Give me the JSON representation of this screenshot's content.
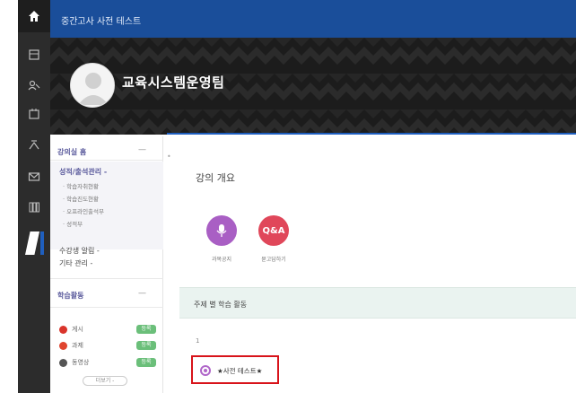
{
  "header": {
    "title": "중간고사 사전 테스트"
  },
  "banner": {
    "org_name": "교육시스템운영팀"
  },
  "sidebar": {
    "course_home": "강의실 홈",
    "course_home_toggle": "—",
    "grade_menu": "성적/출석관리 -",
    "grade_sub": [
      "· 학습자취현황",
      "· 학습진도현황",
      "· 오프라인출석부",
      "· 성적부"
    ],
    "participant_menu": "수강생 알림 -",
    "etc_menu": "기타 관리 -",
    "activities_title": "학습활동",
    "activities_toggle": "—",
    "activities": [
      {
        "label": "게시",
        "badge": "등록",
        "color": "#d9342b"
      },
      {
        "label": "과제",
        "badge": "등록",
        "color": "#e0452f"
      },
      {
        "label": "동영상",
        "badge": "등록",
        "color": "#555555"
      }
    ],
    "more_label": "더보기 -"
  },
  "main": {
    "section_title": "강의 개요",
    "buttons": [
      {
        "label": "과목공지",
        "color": "#a95fc4"
      },
      {
        "label": "Q&A",
        "sublabel": "묻고답하기",
        "color": "#e0475a"
      }
    ],
    "topic_title": "주제 별 학습 활동",
    "week_number": "1",
    "activity": "★사전 테스트★"
  }
}
